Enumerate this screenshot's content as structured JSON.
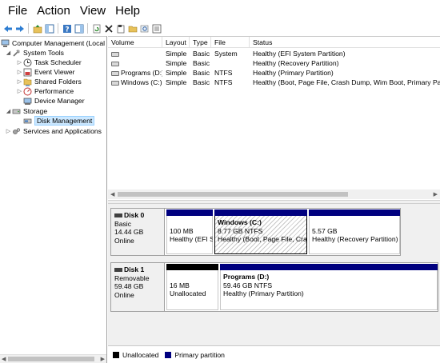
{
  "menu": {
    "file": "File",
    "action": "Action",
    "view": "View",
    "help": "Help"
  },
  "toolbar": {
    "icons": [
      "back-icon",
      "forward-icon",
      "up-folder-icon",
      "show-hide-tree-icon",
      "help-icon",
      "show-hide-action-pane-icon",
      "refresh-icon",
      "delete-icon",
      "properties-icon",
      "open-folder-icon",
      "search-icon",
      "export-list-icon"
    ]
  },
  "tree": {
    "root": "Computer Management (Local",
    "system_tools": "System Tools",
    "task_scheduler": "Task Scheduler",
    "event_viewer": "Event Viewer",
    "shared_folders": "Shared Folders",
    "performance": "Performance",
    "device_manager": "Device Manager",
    "storage": "Storage",
    "disk_management": "Disk Management",
    "services_apps": "Services and Applications"
  },
  "volumes": {
    "headers": {
      "volume": "Volume",
      "layout": "Layout",
      "type": "Type",
      "fs": "File System",
      "status": "Status"
    },
    "rows": [
      {
        "volume": "",
        "layout": "Simple",
        "type": "Basic",
        "fs": "",
        "status": "Healthy (EFI System Partition)"
      },
      {
        "volume": "",
        "layout": "Simple",
        "type": "Basic",
        "fs": "",
        "status": "Healthy (Recovery Partition)"
      },
      {
        "volume": "Programs (D:)",
        "layout": "Simple",
        "type": "Basic",
        "fs": "NTFS",
        "status": "Healthy (Primary Partition)"
      },
      {
        "volume": "Windows (C:)",
        "layout": "Simple",
        "type": "Basic",
        "fs": "NTFS",
        "status": "Healthy (Boot, Page File, Crash Dump, Wim Boot, Primary Partit"
      }
    ]
  },
  "disks": {
    "disk0": {
      "name": "Disk 0",
      "type": "Basic",
      "size": "14.44 GB",
      "state": "Online",
      "p1": {
        "size": "100 MB",
        "status": "Healthy (EFI S"
      },
      "p2": {
        "title": "Windows  (C:)",
        "size": "8.77 GB NTFS",
        "status": "Healthy (Boot, Page File, Cras"
      },
      "p3": {
        "size": "5.57 GB",
        "status": "Healthy (Recovery Partition)"
      }
    },
    "disk1": {
      "name": "Disk 1",
      "type": "Removable",
      "size": "59.48 GB",
      "state": "Online",
      "p1": {
        "size": "16 MB",
        "status": "Unallocated"
      },
      "p2": {
        "title": "Programs  (D:)",
        "size": "59.46 GB NTFS",
        "status": "Healthy (Primary Partition)"
      }
    }
  },
  "legend": {
    "unallocated": "Unallocated",
    "primary": "Primary partition"
  },
  "colors": {
    "primary": "#00007f",
    "unallocated": "#000000",
    "selection": "#cce8ff"
  }
}
